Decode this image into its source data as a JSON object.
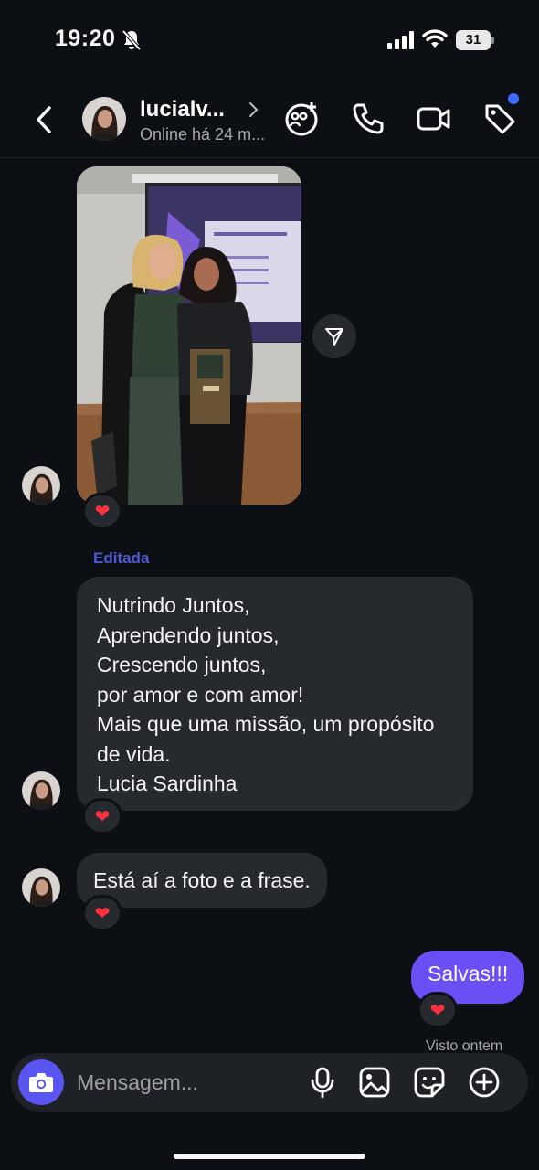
{
  "status_bar": {
    "time": "19:20",
    "battery": "31"
  },
  "header": {
    "name": "lucialv...",
    "status": "Online há 24 m..."
  },
  "messages": {
    "edited_label": "Editada",
    "poem": [
      "Nutrindo Juntos,",
      "Aprendendo juntos,",
      "Crescendo juntos,",
      "por amor e com amor!",
      "Mais que uma missão, um propósito",
      "de vida.",
      "Lucia Sardinha"
    ],
    "follow_up": "Está aí a foto e a frase.",
    "sent": "Salvas!!!",
    "seen": "Visto ontem",
    "reaction": "❤"
  },
  "composer": {
    "placeholder": "Mensagem..."
  },
  "colors": {
    "accent": "#6a4ff5",
    "camera": "#5a54f0",
    "heart": "#ff3040",
    "edited": "#4f5bd5"
  }
}
